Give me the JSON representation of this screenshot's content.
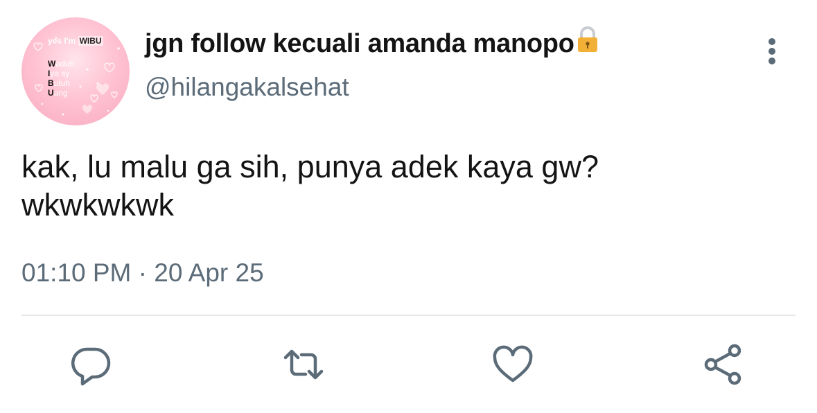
{
  "avatar": {
    "top_text": "yes I'm",
    "top_bold": "WIBU",
    "lines": [
      {
        "initial": "W",
        "rest": "aduh"
      },
      {
        "initial": "I",
        "rest": "ya sy"
      },
      {
        "initial": "B",
        "rest": "utuh"
      },
      {
        "initial": "U",
        "rest": "ang"
      }
    ]
  },
  "user": {
    "display_name": "jgn follow kecuali amanda manopo",
    "handle": "@hilangakalsehat",
    "locked": true
  },
  "tweet": {
    "text_line1": "kak, lu malu ga sih, punya adek kaya gw?",
    "text_line2": "wkwkwkwk",
    "time": "01:10 PM",
    "separator": "·",
    "date": "20 Apr 25"
  },
  "icons": {
    "more": "more-vertical-icon",
    "reply": "reply-icon",
    "retweet": "retweet-icon",
    "like": "heart-icon",
    "share": "share-icon",
    "lock": "lock-icon"
  },
  "colors": {
    "text": "#141414",
    "secondary": "#5b6b78",
    "divider": "#e4e8eb",
    "lock": "#f2b136"
  }
}
